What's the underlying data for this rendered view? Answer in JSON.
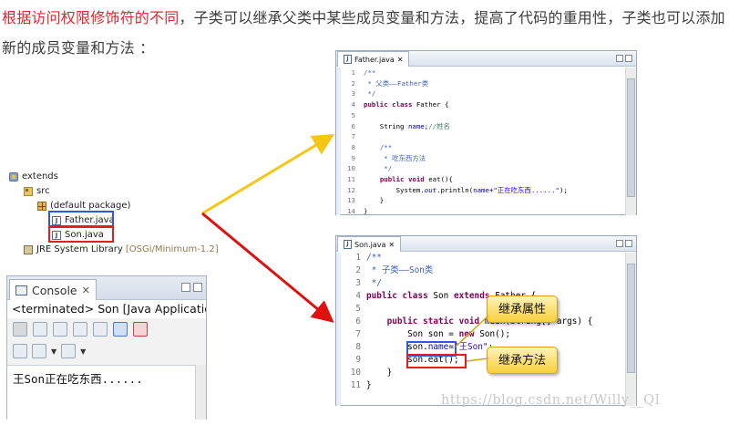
{
  "intro": {
    "highlight": "根据访问权限修饰符的不同",
    "rest": "，子类可以继承父类中某些成员变量和方法，提高了代码的重用性，子类也可以添加新的成员变量和方法 ："
  },
  "tree": {
    "project": "extends",
    "src": "src",
    "package": "(default package)",
    "file1": "Father.java",
    "file2": "Son.java",
    "library": "JRE System Library",
    "library_suffix": "[OSGi/Minimum-1.2]"
  },
  "console": {
    "tab_label": "Console",
    "status": "<terminated> Son [Java Application",
    "output": "王Son正在吃东西......"
  },
  "father_editor": {
    "tab_label": "Father.java",
    "lines": [
      {
        "n": "1",
        "html": "<span class='cm'>/**</span>"
      },
      {
        "n": "2",
        "html": "<span class='cm'> * 父类——Father类</span>"
      },
      {
        "n": "3",
        "html": "<span class='cm'> */</span>"
      },
      {
        "n": "4",
        "html": "<span class='kw'>public class</span> Father {"
      },
      {
        "n": "5",
        "html": ""
      },
      {
        "n": "6",
        "html": "    String <span class='fd'>name</span>;<span class='cl'>//姓名</span>"
      },
      {
        "n": "7",
        "html": ""
      },
      {
        "n": "8",
        "html": "    <span class='cm'>/**</span>"
      },
      {
        "n": "9",
        "html": "<span class='cm'>     * 吃东西方法</span>"
      },
      {
        "n": "10",
        "html": "<span class='cm'>     */</span>"
      },
      {
        "n": "11",
        "html": "    <span class='kw'>public void</span> eat(){"
      },
      {
        "n": "12",
        "html": "        System.<span class='it'>out</span>.println(<span class='fd'>name</span>+<span class='st'>\"正在吃东西......\"</span>);"
      },
      {
        "n": "13",
        "html": "    }"
      },
      {
        "n": "14",
        "html": "}"
      }
    ]
  },
  "son_editor": {
    "tab_label": "Son.java",
    "lines": [
      {
        "n": "1",
        "html": "<span class='cm'>/**</span>"
      },
      {
        "n": "2",
        "html": "<span class='cm'> * 子类——Son类</span>"
      },
      {
        "n": "3",
        "html": "<span class='cm'> */</span>"
      },
      {
        "n": "4",
        "html": "<span class='kw'>public class</span> Son <span class='kw'>extends</span> Father {"
      },
      {
        "n": "5",
        "html": ""
      },
      {
        "n": "6",
        "html": "    <span class='kw'>public static void</span> main(String[] args) {"
      },
      {
        "n": "7",
        "html": "        Son son = <span class='kw'>new</span> Son();"
      },
      {
        "n": "8",
        "html": "        son.<span class='fd'>name</span>=<span class='st'>\"王Son\"</span>;"
      },
      {
        "n": "9",
        "html": "        son.eat();"
      },
      {
        "n": "10",
        "html": "    }"
      },
      {
        "n": "11",
        "html": "}"
      }
    ]
  },
  "callouts": {
    "inherit_field": "继承属性",
    "inherit_method": "继承方法"
  },
  "watermark": "https://blog.csdn.net/Willy__QI",
  "colors": {
    "highlight_red": "#e0272f",
    "box_blue": "#2f5bd0",
    "box_red": "#e02020",
    "arrow_yellow": "#f5c518",
    "arrow_red": "#e01010"
  }
}
